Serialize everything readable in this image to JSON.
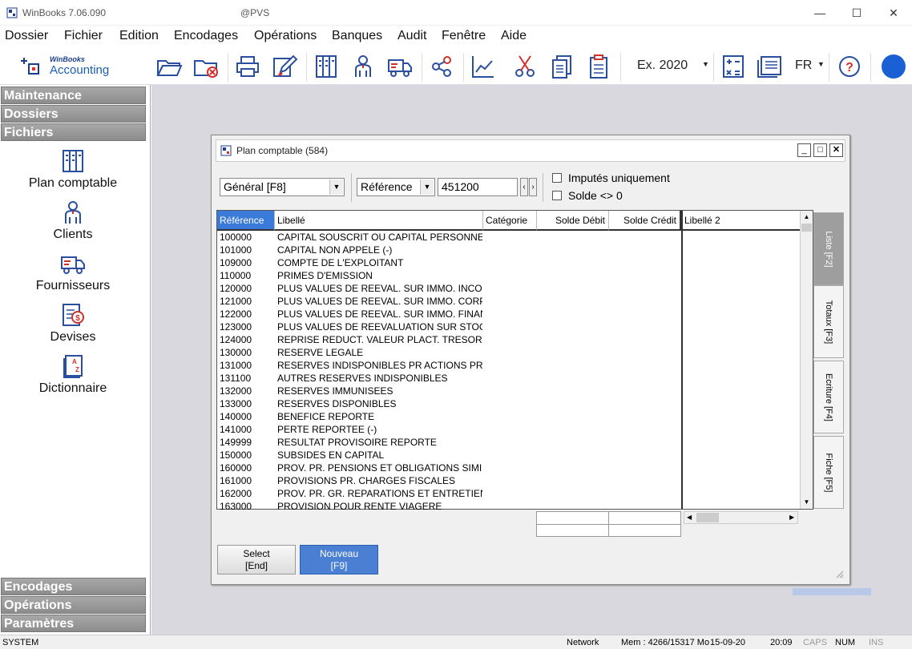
{
  "window": {
    "title": "WinBooks 7.06.090",
    "center_label": "@PVS"
  },
  "menu": [
    "Dossier",
    "Fichier",
    "Edition",
    "Encodages",
    "Opérations",
    "Banques",
    "Audit",
    "Fenêtre",
    "Aide"
  ],
  "toolbar": {
    "logo_brand": "WinBooks",
    "logo_product": "Accounting",
    "exercise": "Ex. 2020",
    "language": "FR",
    "icons": [
      "folder-open-icon",
      "folder-close-icon",
      "print-icon",
      "edit-icon",
      "ledger-icon",
      "person-icon",
      "truck-icon",
      "share-icon",
      "chart-icon",
      "scissors-icon",
      "documents-icon",
      "clipboard-icon",
      "calculator-icon",
      "report-icon",
      "help-icon",
      "status-circle-icon"
    ]
  },
  "sidebar": {
    "sections_top": [
      "Maintenance",
      "Dossiers",
      "Fichiers"
    ],
    "items": [
      {
        "label": "Plan comptable",
        "icon": "ledger-icon"
      },
      {
        "label": "Clients",
        "icon": "person-icon"
      },
      {
        "label": "Fournisseurs",
        "icon": "truck-icon"
      },
      {
        "label": "Devises",
        "icon": "currency-icon"
      },
      {
        "label": "Dictionnaire",
        "icon": "dictionary-icon"
      }
    ],
    "sections_bottom": [
      "Encodages",
      "Opérations",
      "Paramètres"
    ]
  },
  "dialog": {
    "title": "Plan comptable (584)",
    "filter_combo": "Général [F8]",
    "search_field_combo": "Référence",
    "search_value": "451200",
    "checkbox_imputes": "Imputés uniquement",
    "checkbox_solde": "Solde <> 0",
    "columns": [
      "Référence",
      "Libellé",
      "Catégorie",
      "Solde Débit",
      "Solde Crédit",
      "Libellé 2"
    ],
    "rows": [
      [
        "100000",
        "CAPITAL SOUSCRIT OU CAPITAL PERSONNEL"
      ],
      [
        "101000",
        "CAPITAL NON APPELE (-)"
      ],
      [
        "109000",
        "COMPTE DE L'EXPLOITANT"
      ],
      [
        "110000",
        "PRIMES D'EMISSION"
      ],
      [
        "120000",
        "PLUS VALUES DE REEVAL. SUR IMMO. INCOR"
      ],
      [
        "121000",
        "PLUS VALUES DE REEVAL. SUR IMMO. CORP."
      ],
      [
        "122000",
        "PLUS VALUES DE REEVAL. SUR IMMO. FINANC"
      ],
      [
        "123000",
        "PLUS VALUES DE REEVALUATION SUR STOCK"
      ],
      [
        "124000",
        "REPRISE REDUCT. VALEUR PLACT. TRESORI"
      ],
      [
        "130000",
        "RESERVE LEGALE"
      ],
      [
        "131000",
        "RESERVES INDISPONIBLES PR ACTIONS PRO"
      ],
      [
        "131100",
        "AUTRES RESERVES INDISPONIBLES"
      ],
      [
        "132000",
        "RESERVES IMMUNISEES"
      ],
      [
        "133000",
        "RESERVES DISPONIBLES"
      ],
      [
        "140000",
        "BENEFICE REPORTE"
      ],
      [
        "141000",
        "PERTE REPORTEE (-)"
      ],
      [
        "149999",
        "RESULTAT PROVISOIRE REPORTE"
      ],
      [
        "150000",
        "SUBSIDES EN CAPITAL"
      ],
      [
        "160000",
        "PROV. PR. PENSIONS ET OBLIGATIONS SIMIL"
      ],
      [
        "161000",
        "PROVISIONS PR. CHARGES FISCALES"
      ],
      [
        "162000",
        "PROV. PR.  GR. REPARATIONS ET ENTRETIEN"
      ],
      [
        "163000",
        "PROVISION POUR  RENTE VIAGERE"
      ]
    ],
    "tabs": [
      "Liste [F2]",
      "Totaux [F3]",
      "Ecriture [F4]",
      "Fiche [F5]"
    ],
    "btn_select": [
      "Select",
      "[End]"
    ],
    "btn_nouveau": [
      "Nouveau",
      "[F9]"
    ]
  },
  "statusbar": {
    "user": "SYSTEM",
    "network": "Network",
    "mem": "Mem : 4266/15317 Mo",
    "date": "15-09-20",
    "time": "20:09",
    "caps": "CAPS",
    "num": "NUM",
    "ins": "INS"
  }
}
